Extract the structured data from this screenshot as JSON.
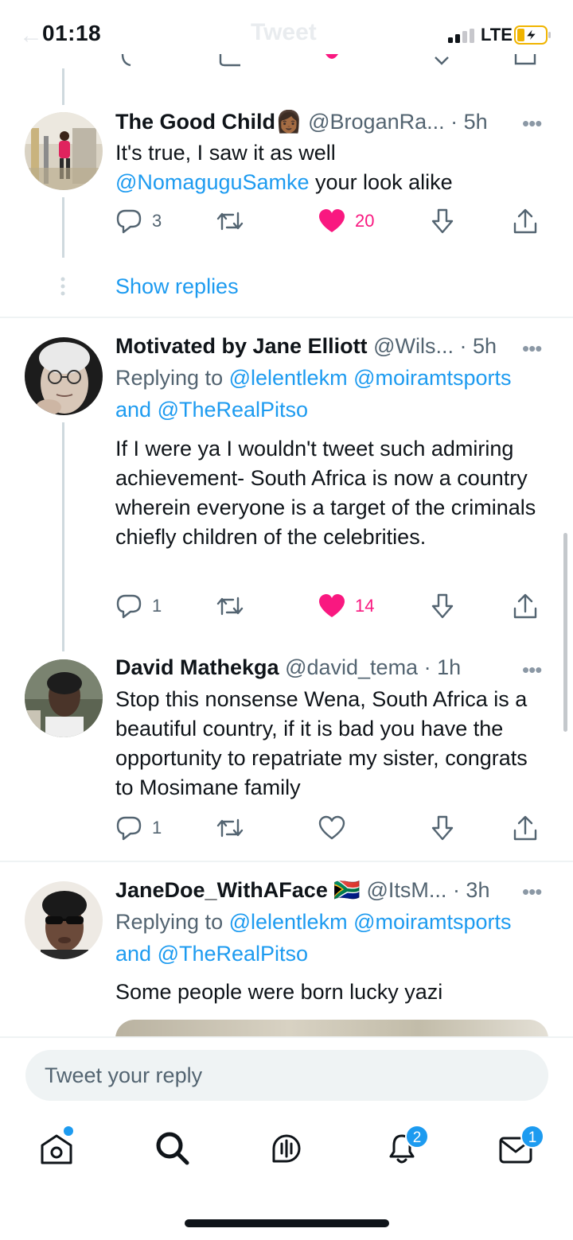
{
  "status_bar": {
    "time": "01:18",
    "network": "LTE",
    "faded_title": "Tweet"
  },
  "tweets": [
    {
      "name": "The Good Child",
      "emoji": "👩🏾",
      "handle": "@BroganRa...",
      "time": "· 5h",
      "text_plain": "It's true, I saw it as well",
      "text_mention": "@NomaguguSamke",
      "text_tail": " your look alike",
      "replies": "3",
      "likes": "20",
      "liked": true
    },
    {
      "name": "Motivated by Jane Elliott",
      "handle": "@Wils...",
      "time": "· 5h",
      "replying_prefix": "Replying to ",
      "replying_mention1": "@lelentlekm",
      "replying_mention2": "@moiramtsports",
      "replying_and": "and ",
      "replying_mention3": "@TheRealPitso",
      "text": "If I were ya I wouldn't tweet such admiring achievement- South Africa is now a country wherein everyone is a target of the criminals chiefly children of the celebrities.",
      "replies": "1",
      "likes": "14",
      "liked": true
    },
    {
      "name": "David Mathekga",
      "handle": "@david_tema",
      "time": "· 1h",
      "text": "Stop this nonsense Wena, South Africa is a beautiful country, if it is bad you have the opportunity to repatriate my sister, congrats to Mosimane family",
      "replies": "1",
      "liked": false
    },
    {
      "name": "JaneDoe_WithAFace",
      "flag": "🇿🇦",
      "handle": "@ItsM...",
      "time": "· 3h",
      "replying_prefix": "Replying to ",
      "replying_mention1": "@lelentlekm",
      "replying_mention2": "@moiramtsports",
      "replying_and": "and ",
      "replying_mention3": "@TheRealPitso",
      "text": "Some people were born lucky yazi"
    }
  ],
  "show_replies": "Show replies",
  "more_glyph": "•••",
  "reply_box": {
    "placeholder": "Tweet your reply"
  },
  "tab_bar": {
    "items": [
      "home-icon",
      "search-icon",
      "spaces-icon",
      "notifications-icon",
      "messages-icon"
    ],
    "notifications_badge": "2",
    "messages_badge": "1"
  },
  "colors": {
    "accent": "#1d9bf0",
    "like": "#f91880",
    "muted": "#536471"
  }
}
